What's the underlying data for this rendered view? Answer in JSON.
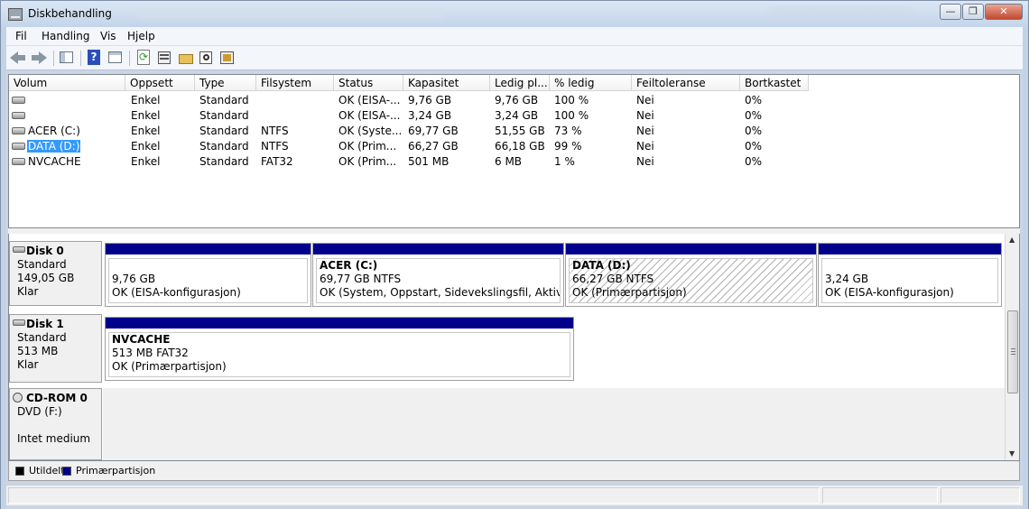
{
  "window": {
    "title": "Diskbehandling",
    "min_glyph": "—",
    "max_glyph": "❐",
    "close_glyph": "✕"
  },
  "menu": [
    "Fil",
    "Handling",
    "Vis",
    "Hjelp"
  ],
  "toolbar": {
    "icons": [
      "back-arrow-icon",
      "forward-arrow-icon",
      "show-hide-console-tree-icon",
      "help-icon",
      "properties-panel-icon",
      "refresh-icon",
      "properties-icon",
      "open-folder-icon",
      "explore-icon",
      "rescan-disks-icon"
    ],
    "help_glyph": "?",
    "refresh_glyph": "⟳"
  },
  "volume_table": {
    "headers": [
      "Volum",
      "Oppsett",
      "Type",
      "Filsystem",
      "Status",
      "Kapasitet",
      "Ledig pl...",
      "% ledig",
      "Feiltoleranse",
      "Bortkastet"
    ],
    "rows": [
      {
        "volum": "",
        "oppsett": "Enkel",
        "type": "Standard",
        "filsystem": "",
        "status": "OK (EISA-...",
        "kapasitet": "9,76 GB",
        "ledig": "9,76 GB",
        "prosent": "100 %",
        "feiltoleranse": "Nei",
        "bortkastet": "0%"
      },
      {
        "volum": "",
        "oppsett": "Enkel",
        "type": "Standard",
        "filsystem": "",
        "status": "OK (EISA-...",
        "kapasitet": "3,24 GB",
        "ledig": "3,24 GB",
        "prosent": "100 %",
        "feiltoleranse": "Nei",
        "bortkastet": "0%"
      },
      {
        "volum": "ACER (C:)",
        "oppsett": "Enkel",
        "type": "Standard",
        "filsystem": "NTFS",
        "status": "OK (Syste...",
        "kapasitet": "69,77 GB",
        "ledig": "51,55 GB",
        "prosent": "73 %",
        "feiltoleranse": "Nei",
        "bortkastet": "0%"
      },
      {
        "volum": "DATA (D:)",
        "oppsett": "Enkel",
        "type": "Standard",
        "filsystem": "NTFS",
        "status": "OK (Prim...",
        "kapasitet": "66,27 GB",
        "ledig": "66,18 GB",
        "prosent": "99 %",
        "feiltoleranse": "Nei",
        "bortkastet": "0%"
      },
      {
        "volum": "NVCACHE",
        "oppsett": "Enkel",
        "type": "Standard",
        "filsystem": "FAT32",
        "status": "OK (Prim...",
        "kapasitet": "501 MB",
        "ledig": "6 MB",
        "prosent": "1 %",
        "feiltoleranse": "Nei",
        "bortkastet": "0%"
      }
    ]
  },
  "disks": [
    {
      "name": "Disk 0",
      "type": "Standard",
      "size": "149,05 GB",
      "state": "Klar",
      "partitions": [
        {
          "name": "",
          "size_fs": "9,76 GB",
          "status": "OK (EISA-konfigurasjon)"
        },
        {
          "name": "ACER  (C:)",
          "size_fs": "69,77 GB NTFS",
          "status": "OK (System, Oppstart, Sidevekslingsfil, Aktiv, Krasj"
        },
        {
          "name": "DATA  (D:)",
          "size_fs": "66,27 GB NTFS",
          "status": "OK (Primærpartisjon)"
        },
        {
          "name": "",
          "size_fs": "3,24 GB",
          "status": "OK (EISA-konfigurasjon)"
        }
      ]
    },
    {
      "name": "Disk 1",
      "type": "Standard",
      "size": "513 MB",
      "state": "Klar",
      "partitions": [
        {
          "name": "NVCACHE",
          "size_fs": "513 MB FAT32",
          "status": "OK (Primærpartisjon)"
        }
      ]
    },
    {
      "name": "CD-ROM 0",
      "type": "DVD (F:)",
      "size": "",
      "state": "Intet medium",
      "partitions": []
    }
  ],
  "legend": [
    "Utildelt",
    "Primærpartisjon"
  ],
  "colors": {
    "primary_partition": "#00008b",
    "unallocated": "#000000",
    "selection": "#3399ff"
  }
}
